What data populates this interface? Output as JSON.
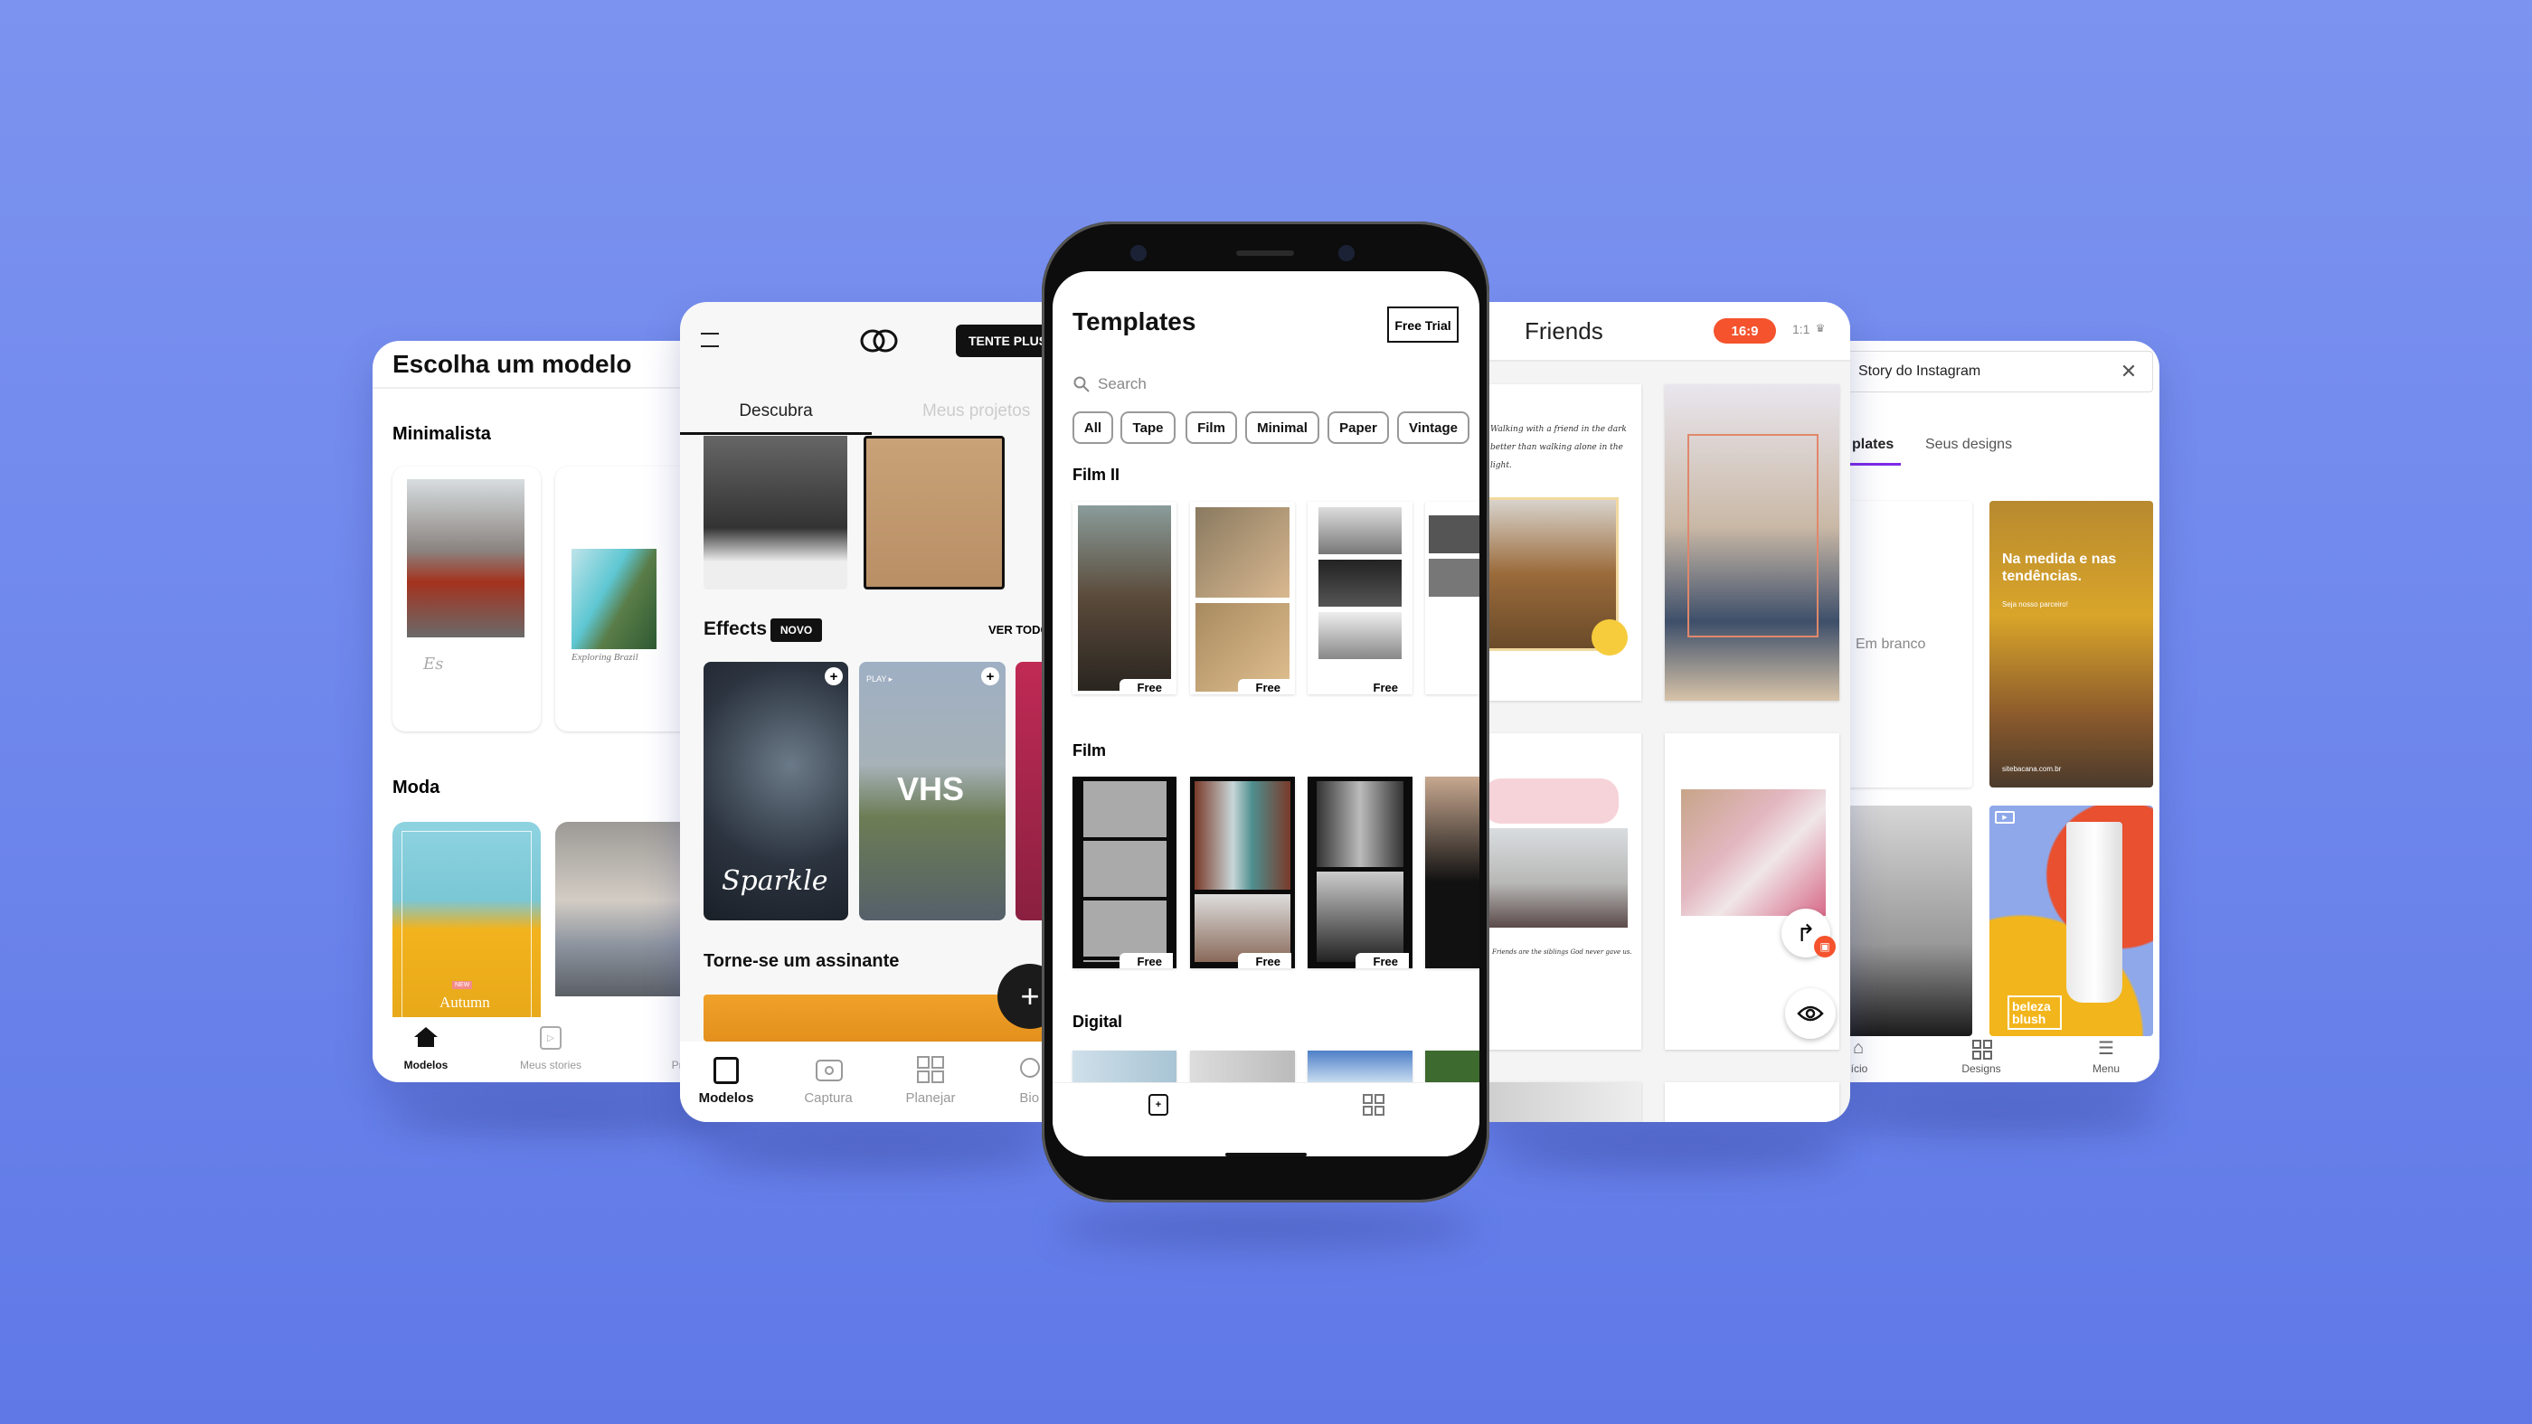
{
  "colors": {
    "background": "#6f88ec",
    "accent_orange": "#f4532d",
    "accent_purple": "#7d2ae8",
    "dark": "#111111"
  },
  "panel_escolha": {
    "title": "Escolha um modelo",
    "section_minimalista": "Minimalista",
    "card_caption_1": "Es",
    "card_caption_2": "Exploring Brazil",
    "section_moda": "Moda",
    "moda_badge": "NEW",
    "moda_caption": "Autumn",
    "nav": [
      {
        "label": "Modelos",
        "icon": "home-icon"
      },
      {
        "label": "Meus stories",
        "icon": "play-icon"
      },
      {
        "label": "Pro",
        "icon": "pro-icon"
      }
    ]
  },
  "panel_descubra": {
    "cta": "TENTE PLUS",
    "tabs": [
      "Descubra",
      "Meus projetos"
    ],
    "effects_title": "Effects",
    "effects_badge": "NOVO",
    "see_all": "VER TODOS",
    "effect_1_text": "Sparkle",
    "effect_2_text": "VHS",
    "effect_2_tag": "PLAY ▸",
    "subscribe_title": "Torne-se um assinante",
    "nav": [
      {
        "label": "Modelos",
        "icon": "templates-icon"
      },
      {
        "label": "Captura",
        "icon": "camera-icon"
      },
      {
        "label": "Planejar",
        "icon": "grid-icon"
      },
      {
        "label": "Bio Si",
        "icon": "bio-icon"
      }
    ]
  },
  "phone": {
    "title": "Templates",
    "free_trial": "Free Trial",
    "search_placeholder": "Search",
    "chips": [
      "All",
      "Tape",
      "Film",
      "Minimal",
      "Paper",
      "Vintage"
    ],
    "sections": [
      {
        "title": "Film II",
        "badges": [
          "Free",
          "Free",
          "Free"
        ]
      },
      {
        "title": "Film",
        "badges": [
          "Free",
          "Free",
          "Free"
        ]
      },
      {
        "title": "Digital"
      }
    ]
  },
  "panel_friends": {
    "title": "Friends",
    "ratio_active": "16:9",
    "ratio_other": "1:1",
    "quote_1": "Walking with a friend in the dark better than walking alone in the light.",
    "quote_2": "Friends are the siblings God never gave us."
  },
  "panel_canva": {
    "search_value": "Story do Instagram",
    "tabs": [
      "plates",
      "Seus designs"
    ],
    "blank_label": "Em branco",
    "promo_title": "Na medida e nas tendências.",
    "promo_sub": "Seja nosso parceiro!",
    "promo_url": "sitebacana.com.br",
    "product_label": "beleza blush",
    "nav": [
      {
        "label": "ício",
        "icon": "home-icon"
      },
      {
        "label": "Designs",
        "icon": "grid-icon"
      },
      {
        "label": "Menu",
        "icon": "menu-icon"
      }
    ]
  }
}
